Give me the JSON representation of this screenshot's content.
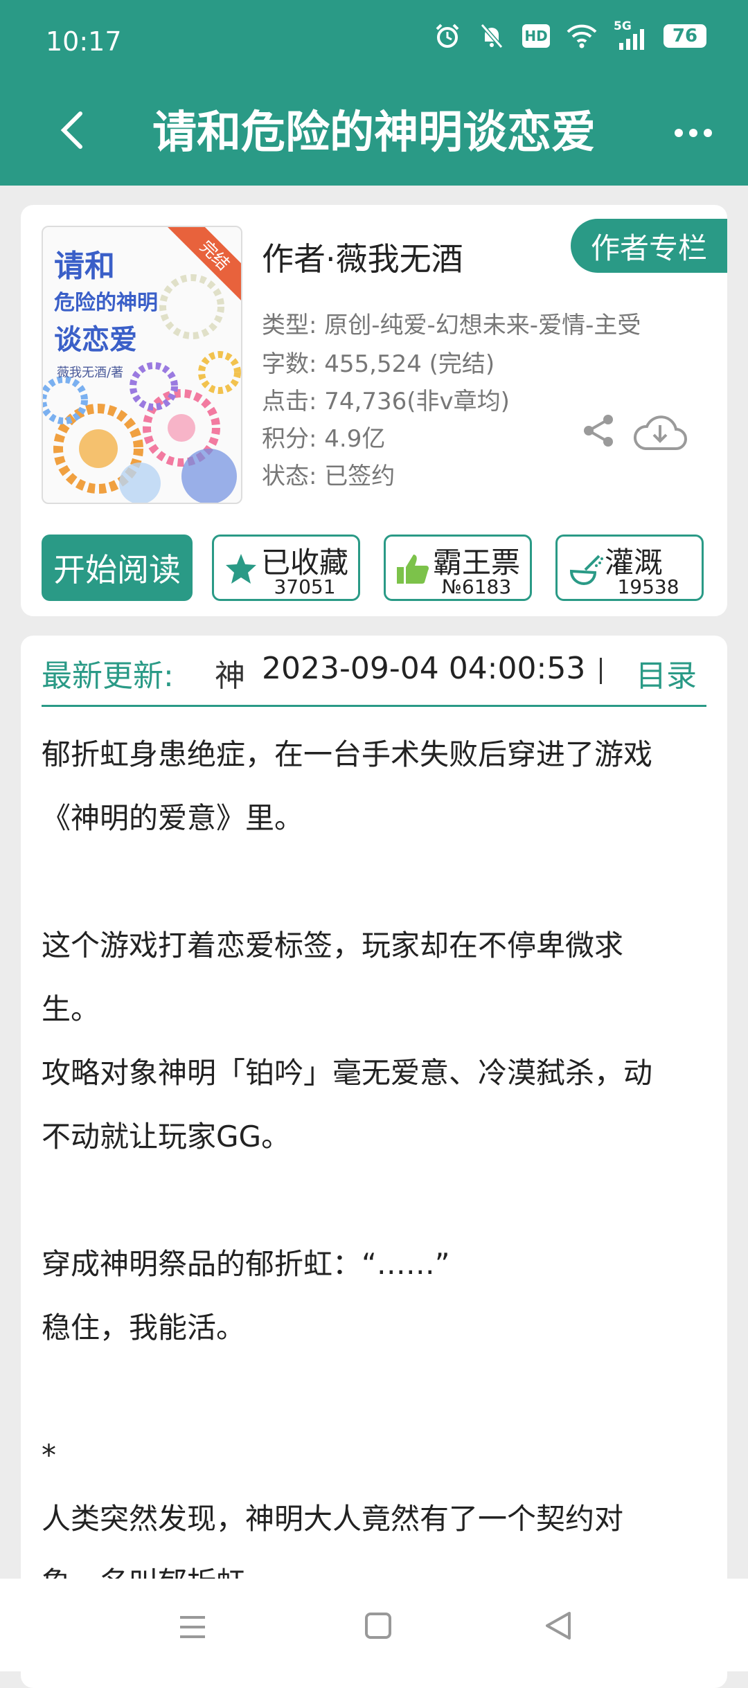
{
  "status_bar": {
    "time": "10:17",
    "battery": "76",
    "hd_badge": "HD",
    "network": "5G",
    "icons": [
      "alarm-icon",
      "mute-icon",
      "hd-icon",
      "wifi-icon",
      "signal-icon",
      "battery-icon"
    ]
  },
  "header": {
    "title": "请和危险的神明谈恋爱",
    "back_icon": "back-chevron-icon",
    "more_icon": "more-dots-icon",
    "color": "#2a9a86"
  },
  "book": {
    "cover": {
      "line1": "请和",
      "line2": "危险的神明",
      "line3": "谈恋爱",
      "author_mark": "薇我无酒/著",
      "ribbon": "完结"
    },
    "author_label": "作者·薇我无酒",
    "author_column_button": "作者专栏",
    "meta": {
      "type": "类型: 原创-纯爱-幻想未来-爱情-主受",
      "words": "字数: 455,524 (完结)",
      "clicks": "点击: 74,736(非v章均)",
      "score": "积分: 4.9亿",
      "status": "状态: 已签约"
    }
  },
  "actions": {
    "read": "开始阅读",
    "collect": {
      "label": "已收藏",
      "count": "37051"
    },
    "ticket": {
      "label": "霸王票",
      "count": "№6183"
    },
    "water": {
      "label": "灌溉",
      "count": "19538"
    }
  },
  "update": {
    "label": "最新更新:",
    "chapter_fragment": "神",
    "date": "2023-09-04 04:00:53",
    "toc": "目录"
  },
  "intro": [
    "郁折虹身患绝症，在一台手术失败后穿进了游戏",
    "《神明的爱意》里。",
    "",
    "这个游戏打着恋爱标签，玩家却在不停卑微求",
    "生。",
    "攻略对象神明「铂吟」毫无爱意、冷漠弑杀，动",
    "不动就让玩家GG。",
    "",
    "穿成神明祭品的郁折虹：“……”",
    "稳住，我能活。",
    "",
    "*",
    "人类突然发现，神明大人竟然有了一个契约对",
    "象，名叫郁折虹。"
  ],
  "nav": {
    "icons": [
      "menu-icon",
      "home-icon",
      "back-triangle-icon"
    ]
  }
}
